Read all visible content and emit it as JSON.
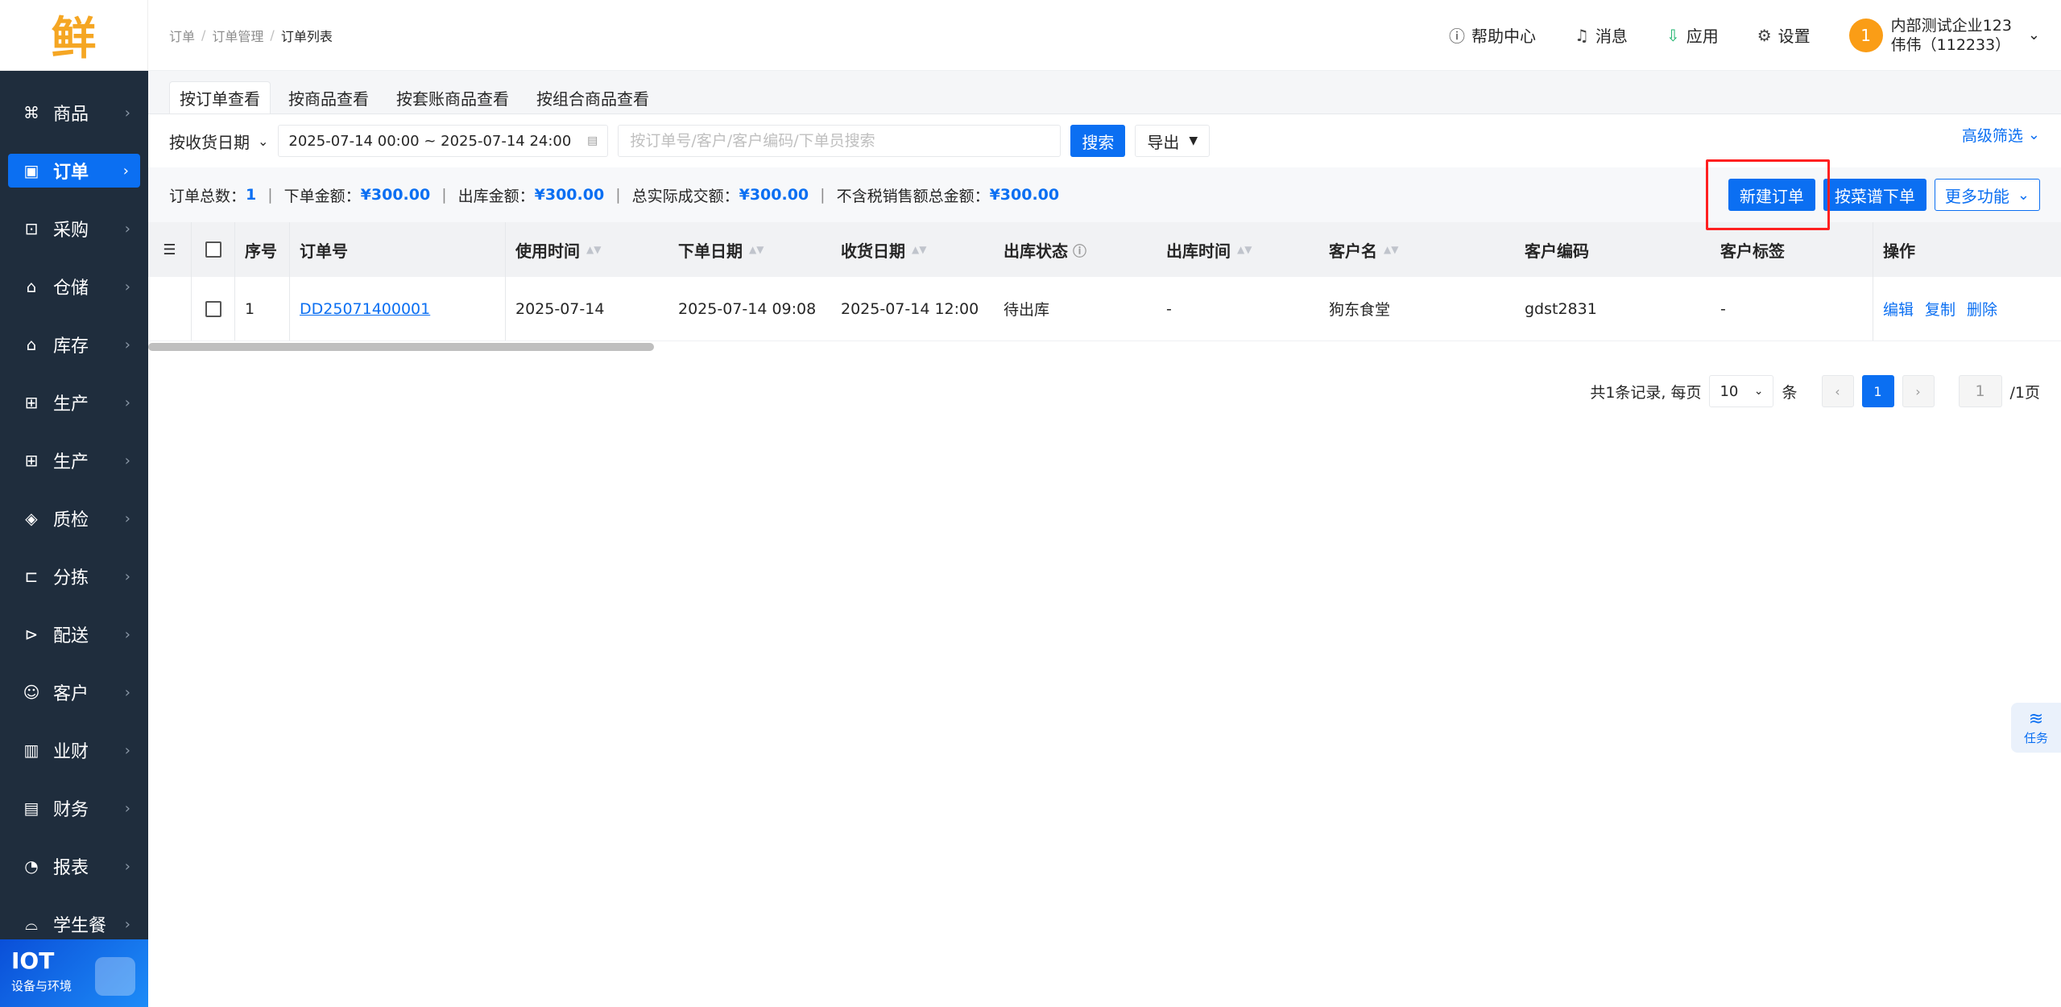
{
  "logo": {
    "text": "鲜"
  },
  "sidebar": {
    "items": [
      {
        "label": "商品",
        "icon": "product-icon",
        "glyph": "⌘",
        "active": false
      },
      {
        "label": "订单",
        "icon": "order-icon",
        "glyph": "▣",
        "active": true
      },
      {
        "label": "采购",
        "icon": "purchase-icon",
        "glyph": "⊡",
        "active": false
      },
      {
        "label": "仓储",
        "icon": "warehouse-icon",
        "glyph": "⌂",
        "active": false
      },
      {
        "label": "库存",
        "icon": "inventory-icon",
        "glyph": "⌂",
        "active": false
      },
      {
        "label": "生产",
        "icon": "production-icon",
        "glyph": "⊞",
        "active": false
      },
      {
        "label": "生产",
        "icon": "production2-icon",
        "glyph": "⊞",
        "active": false
      },
      {
        "label": "质检",
        "icon": "quality-icon",
        "glyph": "◈",
        "active": false
      },
      {
        "label": "分拣",
        "icon": "sorting-icon",
        "glyph": "⊏",
        "active": false
      },
      {
        "label": "配送",
        "icon": "delivery-icon",
        "glyph": "⊳",
        "active": false
      },
      {
        "label": "客户",
        "icon": "customer-icon",
        "glyph": "☺",
        "active": false
      },
      {
        "label": "业财",
        "icon": "business-finance-icon",
        "glyph": "▥",
        "active": false
      },
      {
        "label": "财务",
        "icon": "finance-icon",
        "glyph": "▤",
        "active": false
      },
      {
        "label": "报表",
        "icon": "report-icon",
        "glyph": "◔",
        "active": false
      },
      {
        "label": "学生餐",
        "icon": "student-meal-icon",
        "glyph": "⌓",
        "active": false
      }
    ],
    "iot": {
      "title": "IOT",
      "subtitle": "设备与环境"
    }
  },
  "header": {
    "breadcrumb": [
      "订单",
      "订单管理",
      "订单列表"
    ],
    "help": "帮助中心",
    "messages": "消息",
    "apps": "应用",
    "settings": "设置",
    "user": {
      "avatar": "1",
      "company": "内部测试企业123",
      "name": "伟伟（112233）"
    }
  },
  "tabs": [
    "按订单查看",
    "按商品查看",
    "按套账商品查看",
    "按组合商品查看"
  ],
  "filters": {
    "date_type": "按收货日期",
    "date_range": "2025-07-14 00:00 ~ 2025-07-14 24:00",
    "search_placeholder": "按订单号/客户/客户编码/下单员搜索",
    "search_button": "搜索",
    "export_button": "导出",
    "advanced": "高级筛选"
  },
  "summary": {
    "total_orders_label": "订单总数：",
    "total_orders": "1",
    "order_amount_label": "下单金额：",
    "order_amount": "¥300.00",
    "out_amount_label": "出库金额：",
    "out_amount": "¥300.00",
    "actual_amount_label": "总实际成交额：",
    "actual_amount": "¥300.00",
    "notax_amount_label": "不含税销售额总金额：",
    "notax_amount": "¥300.00",
    "separator": "|"
  },
  "actions": {
    "new_order": "新建订单",
    "menu_order": "按菜谱下单",
    "more": "更多功能"
  },
  "table": {
    "headers": {
      "index": "序号",
      "order_no": "订单号",
      "use_time": "使用时间",
      "order_date": "下单日期",
      "receive_date": "收货日期",
      "out_status": "出库状态",
      "out_time": "出库时间",
      "customer_name": "客户名",
      "customer_code": "客户编码",
      "customer_tag": "客户标签",
      "operation": "操作"
    },
    "rows": [
      {
        "index": "1",
        "order_no": "DD25071400001",
        "use_time": "2025-07-14",
        "order_date": "2025-07-14 09:08",
        "receive_date": "2025-07-14 12:00",
        "out_status": "待出库",
        "out_time": "-",
        "customer_name": "狗东食堂",
        "customer_code": "gdst2831",
        "customer_tag": "-",
        "ops": [
          "编辑",
          "复制",
          "删除"
        ]
      }
    ]
  },
  "pagination": {
    "summary": "共1条记录, 每页",
    "page_size": "10",
    "unit": "条",
    "current": "1",
    "jump_value": "1",
    "total_pages": "/1页"
  },
  "task": {
    "label": "任务"
  }
}
